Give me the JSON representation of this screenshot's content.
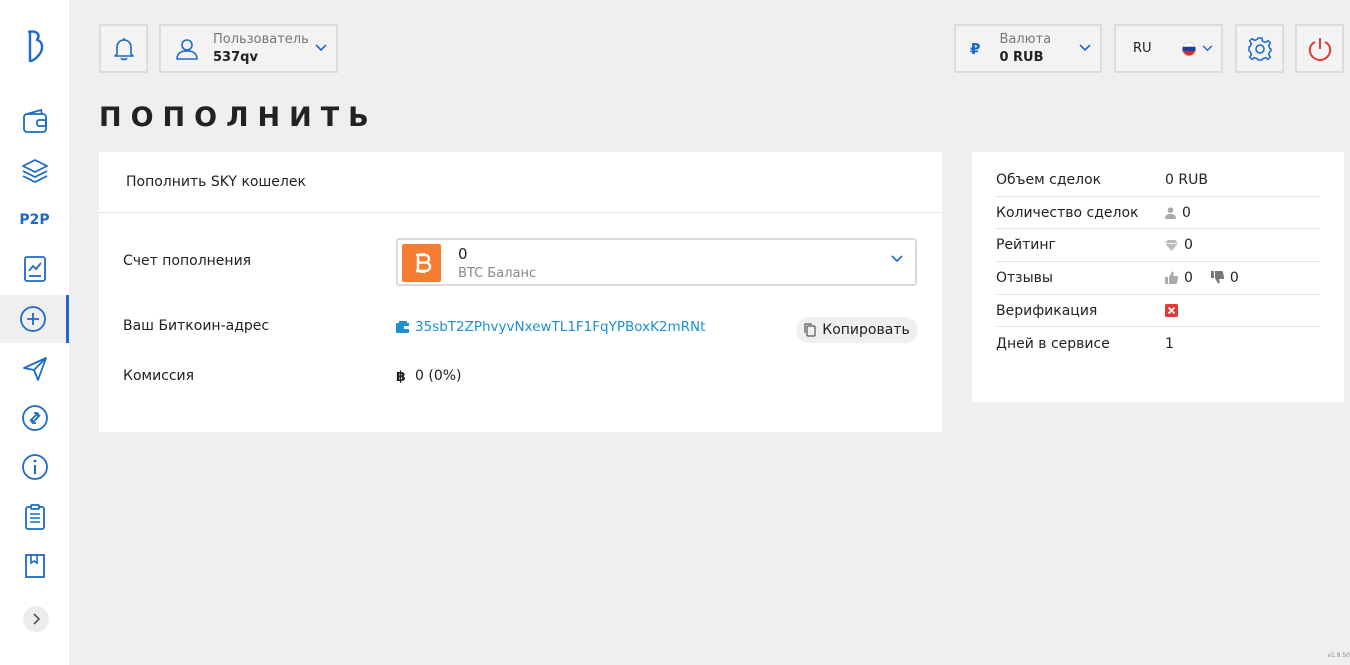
{
  "header": {
    "user_label": "Пользователь",
    "user_value": "537qv",
    "currency_label": "Валюта",
    "currency_value": "0 RUB",
    "currency_symbol": "₽",
    "language": "RU"
  },
  "sidebar": {
    "p2p_label": "P2P",
    "accent": "#1d6ac8"
  },
  "page": {
    "title": "ПОПОЛНИТЬ"
  },
  "deposit": {
    "card_title": "Пополнить SKY кошелек",
    "account_label": "Счет пополнения",
    "account_value": "0",
    "account_sub": "BTC Баланс",
    "address_label": "Ваш Биткоин-адрес",
    "address_value": "35sbT2ZPhvyvNxewTL1F1FqYPBoxK2mRNt",
    "copy_label": "Копировать",
    "fee_label": "Комиссия",
    "fee_symbol": "฿",
    "fee_value": "0 (0%)"
  },
  "stats": {
    "volume_label": "Объем сделок",
    "volume_value": "0 RUB",
    "count_label": "Количество сделок",
    "count_value": "0",
    "rating_label": "Рейтинг",
    "rating_value": "0",
    "reviews_label": "Отзывы",
    "reviews_positive": "0",
    "reviews_negative": "0",
    "verification_label": "Верификация",
    "days_label": "Дней в сервисе",
    "days_value": "1"
  },
  "footer": {
    "version": "v1.9.50"
  },
  "colors": {
    "brand_blue": "#1d6ac8",
    "link_blue": "#1d8fd2",
    "btc_orange": "#f47d33",
    "power_red": "#e53935"
  }
}
